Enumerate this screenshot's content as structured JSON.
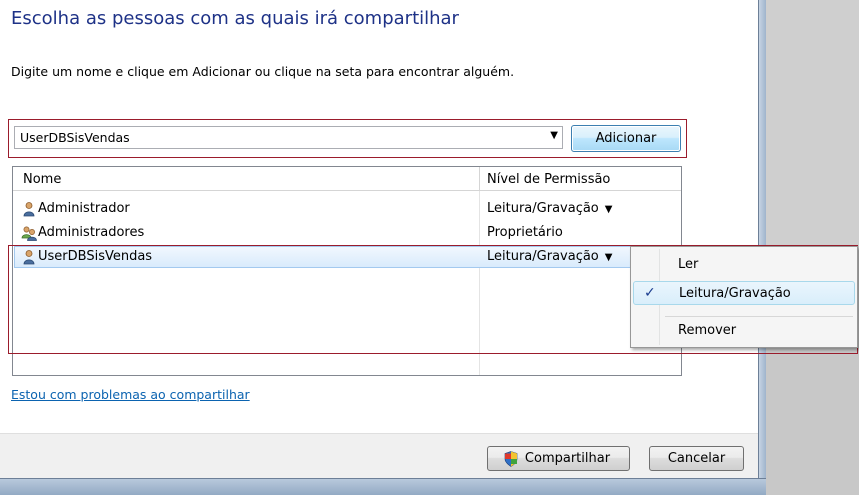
{
  "dialog": {
    "title": "Escolha as pessoas com as quais irá compartilhar",
    "instruction": "Digite um nome e clique em Adicionar ou clique na seta para encontrar alguém."
  },
  "picker": {
    "value": "UserDBSisVendas",
    "add_label": "Adicionar"
  },
  "list": {
    "headers": {
      "name": "Nome",
      "permission": "Nível de Permissão"
    },
    "rows": [
      {
        "name": "Administrador",
        "permission": "Leitura/Gravação",
        "icon": "user-icon"
      },
      {
        "name": "Administradores",
        "permission": "Proprietário",
        "icon": "group-icon"
      },
      {
        "name": "UserDBSisVendas",
        "permission": "Leitura/Gravação",
        "icon": "user-icon"
      }
    ]
  },
  "menu": {
    "items": [
      {
        "label": "Ler",
        "checked": false
      },
      {
        "label": "Leitura/Gravação",
        "checked": true
      },
      {
        "label": "Remover",
        "checked": false
      }
    ]
  },
  "link": "Estou com problemas ao compartilhar",
  "footer": {
    "share_label": "Compartilhar",
    "cancel_label": "Cancelar"
  },
  "colors": {
    "title": "#1e3287",
    "link": "#0b63b0",
    "highlight_frame": "#9b1c2c"
  }
}
